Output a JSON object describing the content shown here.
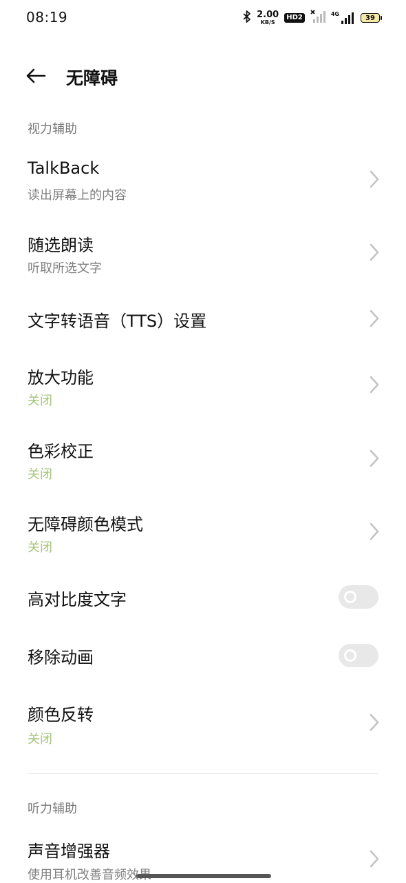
{
  "status_bar": {
    "time": "08:19",
    "net_speed_value": "2.00",
    "net_speed_unit": "KB/S",
    "hd_label": "HD2",
    "network_type": "4G",
    "battery_level": "39"
  },
  "header": {
    "title": "无障碍"
  },
  "sections": {
    "vision": {
      "title": "视力辅助",
      "items": [
        {
          "title": "TalkBack",
          "subtitle": "读出屏幕上的内容"
        },
        {
          "title": "随选朗读",
          "subtitle": "听取所选文字"
        },
        {
          "title": "文字转语音（TTS）设置"
        },
        {
          "title": "放大功能",
          "subtitle": "关闭"
        },
        {
          "title": "色彩校正",
          "subtitle": "关闭"
        },
        {
          "title": "无障碍颜色模式",
          "subtitle": "关闭"
        },
        {
          "title": "高对比度文字",
          "toggle": false
        },
        {
          "title": "移除动画",
          "toggle": false
        },
        {
          "title": "颜色反转",
          "subtitle": "关闭"
        }
      ]
    },
    "hearing": {
      "title": "听力辅助",
      "items": [
        {
          "title": "声音增强器",
          "subtitle": "使用耳机改善音频效果"
        }
      ]
    }
  },
  "colors": {
    "off_status": "#a6c47a",
    "toggle_track": "#e8e8e8"
  }
}
